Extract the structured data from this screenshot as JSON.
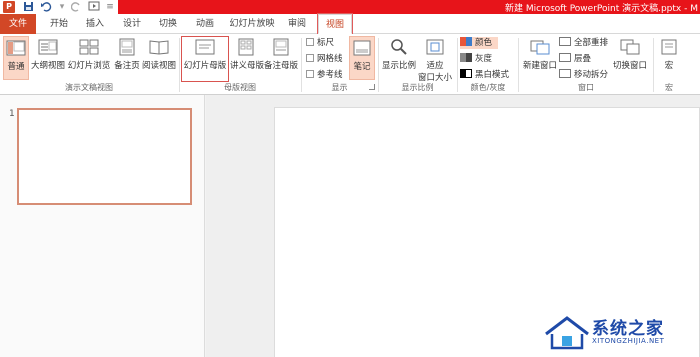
{
  "window": {
    "title": "新建 Microsoft PowerPoint 演示文稿.pptx - M",
    "app_icon_letter": "P"
  },
  "quick_access": {
    "save_icon": "save-icon",
    "undo_icon": "undo-icon",
    "redo_icon": "redo-icon",
    "start_icon": "start-from-beginning-icon"
  },
  "tabs": [
    {
      "label": "文件"
    },
    {
      "label": "开始"
    },
    {
      "label": "插入"
    },
    {
      "label": "设计"
    },
    {
      "label": "切换"
    },
    {
      "label": "动画"
    },
    {
      "label": "幻灯片放映"
    },
    {
      "label": "审阅"
    },
    {
      "label": "视图"
    }
  ],
  "ribbon": {
    "presentation_views": {
      "label": "演示文稿视图",
      "buttons": [
        "普通",
        "大纲视图",
        "幻灯片浏览",
        "备注页",
        "阅读视图"
      ]
    },
    "master_views": {
      "label": "母版视图",
      "buttons": [
        "幻灯片母版",
        "讲义母版",
        "备注母版"
      ]
    },
    "show": {
      "label": "显示",
      "checks": [
        "标尺",
        "网格线",
        "参考线"
      ],
      "notes_button": "笔记"
    },
    "zoom": {
      "label": "显示比例",
      "buttons": [
        "显示比例",
        "适应",
        "窗口大小"
      ]
    },
    "color": {
      "label": "颜色/灰度",
      "options": [
        "颜色",
        "灰度",
        "黑白模式"
      ]
    },
    "window_group": {
      "label": "窗口",
      "new_window": "新建窗口",
      "items": [
        "全部重排",
        "层叠",
        "移动拆分"
      ],
      "switch": "切换窗口"
    },
    "macros": {
      "label": "宏",
      "button": "宏"
    }
  },
  "thumbnails": {
    "slide_number": "1"
  },
  "watermark": {
    "brand": "系统之家",
    "url": "XITONGZHIJIA.NET"
  },
  "colors": {
    "title_red": "#e7141a",
    "file_tab": "#d24726",
    "selected_fill": "#fbd7c7",
    "highlight_box": "#d9534f"
  }
}
